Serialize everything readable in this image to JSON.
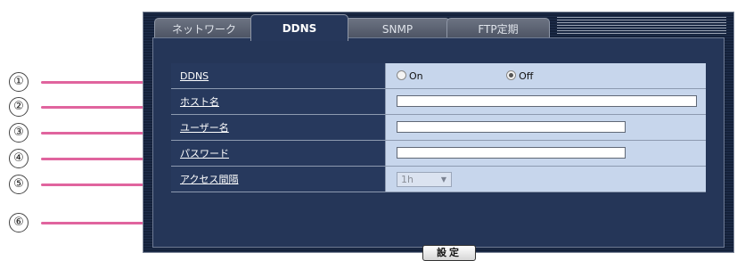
{
  "callouts": [
    "①",
    "②",
    "③",
    "④",
    "⑤",
    "⑥"
  ],
  "tabs": [
    {
      "label": "ネットワーク",
      "active": false
    },
    {
      "label": "DDNS",
      "active": true
    },
    {
      "label": "SNMP",
      "active": false
    },
    {
      "label": "FTP定期",
      "active": false
    }
  ],
  "form": {
    "ddns": {
      "label": "DDNS",
      "on_label": "On",
      "off_label": "Off",
      "selected": "Off"
    },
    "host_name": {
      "label": "ホスト名",
      "value": ""
    },
    "user_name": {
      "label": "ユーザー名",
      "value": ""
    },
    "password": {
      "label": "パスワード",
      "value": ""
    },
    "access_interval": {
      "label": "アクセス間隔",
      "selected": "1h"
    }
  },
  "set_button_label": "設定",
  "colors": {
    "callout_line": "#e0649e",
    "panel_bg": "#14213a",
    "label_bg": "#27395d",
    "value_bg": "#c7d6ec"
  }
}
